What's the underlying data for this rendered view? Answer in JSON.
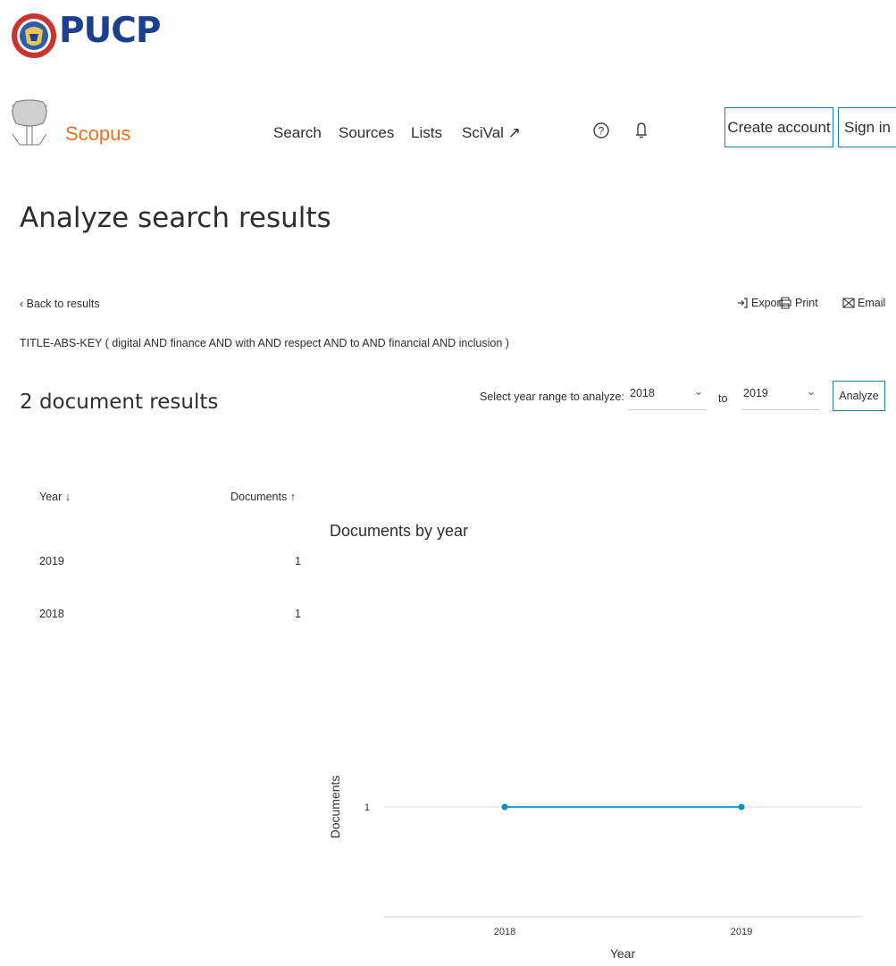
{
  "branding": {
    "institution": "PUCP",
    "product": "Scopus"
  },
  "nav": {
    "search": "Search",
    "sources": "Sources",
    "lists": "Lists",
    "scival": "SciVal ↗"
  },
  "header_buttons": {
    "create_account": "Create account",
    "sign_in": "Sign in"
  },
  "page": {
    "title": "Analyze search results",
    "back_link": "‹ Back to results",
    "export": "Export",
    "print": "Print",
    "email": "Email",
    "query": "TITLE-ABS-KEY ( digital  AND finance  AND with  AND respect  AND to  AND financial  AND inclusion )",
    "result_count": "2 document results"
  },
  "year_range": {
    "label": "Select year range to analyze:",
    "from": "2018",
    "to_label": "to",
    "to": "2019",
    "analyze": "Analyze"
  },
  "table": {
    "col_year": "Year ↓",
    "col_docs": "Documents ↑",
    "rows": [
      {
        "year": "2019",
        "docs": "1"
      },
      {
        "year": "2018",
        "docs": "1"
      }
    ]
  },
  "chart_data": {
    "type": "line",
    "title": "Documents by year",
    "xlabel": "Year",
    "ylabel": "Documents",
    "categories": [
      "2018",
      "2019"
    ],
    "series": [
      {
        "values": [
          1,
          1
        ]
      }
    ],
    "yticks": [
      1
    ],
    "color": "#1aa3d4"
  },
  "colors": {
    "accent_border": "#1f7ea8",
    "scopus_orange": "#e9711c",
    "pucp_blue": "#1d3f8f",
    "line": "#1aa3d4"
  }
}
